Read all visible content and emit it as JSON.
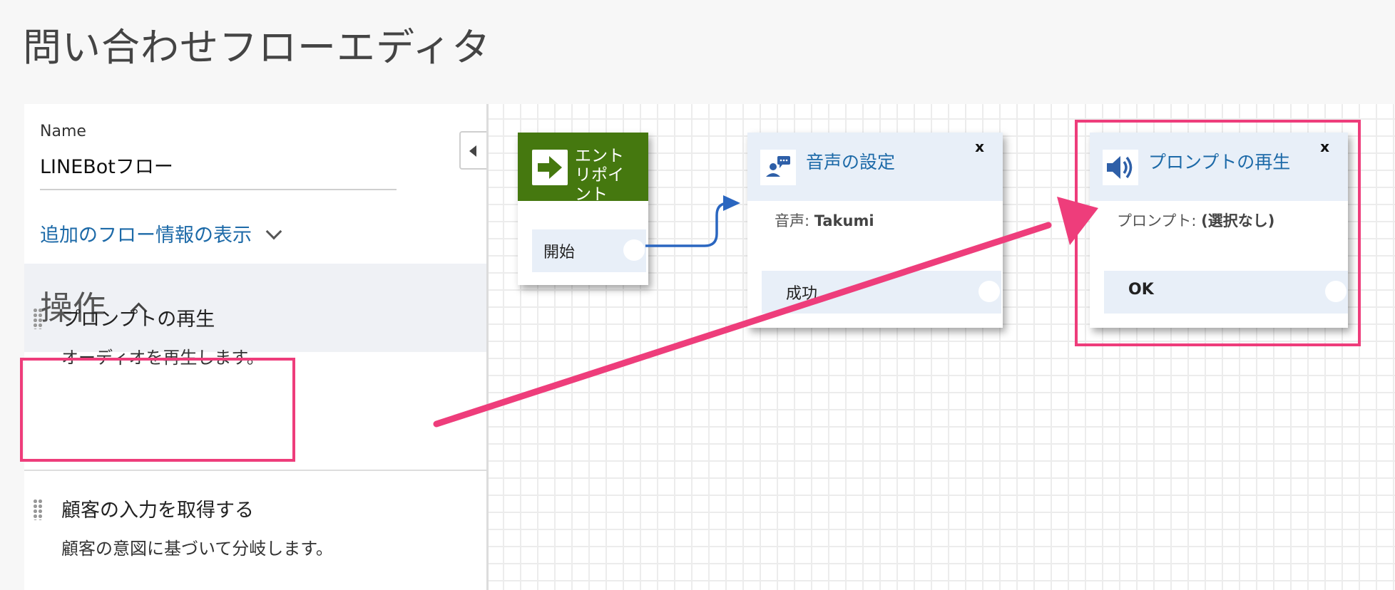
{
  "page": {
    "title": "問い合わせフローエディタ"
  },
  "sidebar": {
    "name_label": "Name",
    "name_value": "LINEBotフロー",
    "more_info_link": "追加のフロー情報の表示",
    "operations_title": "操作",
    "operations": [
      {
        "title": "プロンプトの再生",
        "description": "オーディオを再生します。"
      },
      {
        "title": "顧客の入力を取得する",
        "description": "顧客の意図に基づいて分岐します。"
      }
    ]
  },
  "canvas": {
    "entry_node": {
      "title": "エントリポイント",
      "branch": "開始"
    },
    "voice_node": {
      "title": "音声の設定",
      "close": "x",
      "detail_label": "音声:",
      "detail_value": "Takumi",
      "branch": "成功"
    },
    "prompt_node": {
      "title": "プロンプトの再生",
      "close": "x",
      "detail_label": "プロンプト:",
      "detail_value": "(選択なし)",
      "branch": "OK"
    }
  },
  "colors": {
    "accent": "#1d6aa8",
    "entry_green": "#45780f",
    "highlight": "#ee3d7b",
    "node_header": "#e8eff8"
  }
}
